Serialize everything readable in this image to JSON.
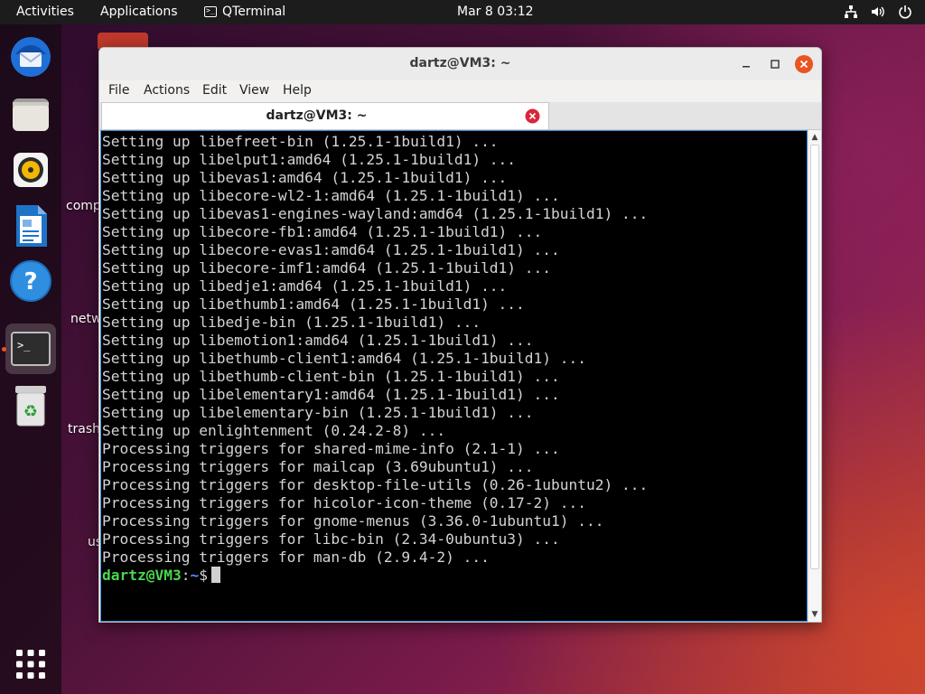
{
  "topbar": {
    "activities": "Activities",
    "applications": "Applications",
    "app_name": "QTerminal",
    "clock": "Mar 8  03:12",
    "tray_icons": [
      "network-icon",
      "volume-icon",
      "power-icon"
    ]
  },
  "dock": {
    "items": [
      {
        "name": "thunderbird-icon"
      },
      {
        "name": "files-icon"
      },
      {
        "name": "rhythmbox-icon"
      },
      {
        "name": "libreoffice-writer-icon"
      },
      {
        "name": "help-icon"
      },
      {
        "name": "terminal-icon",
        "active": true
      },
      {
        "name": "trash-icon"
      }
    ],
    "app_grid": "show-applications-icon"
  },
  "desktop": {
    "labels": [
      "comp",
      "netw",
      "trash",
      "us"
    ]
  },
  "window": {
    "title": "dartz@VM3: ~",
    "menu": [
      "File",
      "Actions",
      "Edit",
      "View",
      "Help"
    ],
    "tab_label": "dartz@VM3: ~",
    "accent": "#3b8ed8",
    "close_color": "#e95420"
  },
  "terminal": {
    "lines": [
      "Setting up libefreet-bin (1.25.1-1build1) ...",
      "Setting up libelput1:amd64 (1.25.1-1build1) ...",
      "Setting up libevas1:amd64 (1.25.1-1build1) ...",
      "Setting up libecore-wl2-1:amd64 (1.25.1-1build1) ...",
      "Setting up libevas1-engines-wayland:amd64 (1.25.1-1build1) ...",
      "Setting up libecore-fb1:amd64 (1.25.1-1build1) ...",
      "Setting up libecore-evas1:amd64 (1.25.1-1build1) ...",
      "Setting up libecore-imf1:amd64 (1.25.1-1build1) ...",
      "Setting up libedje1:amd64 (1.25.1-1build1) ...",
      "Setting up libethumb1:amd64 (1.25.1-1build1) ...",
      "Setting up libedje-bin (1.25.1-1build1) ...",
      "Setting up libemotion1:amd64 (1.25.1-1build1) ...",
      "Setting up libethumb-client1:amd64 (1.25.1-1build1) ...",
      "Setting up libethumb-client-bin (1.25.1-1build1) ...",
      "Setting up libelementary1:amd64 (1.25.1-1build1) ...",
      "Setting up libelementary-bin (1.25.1-1build1) ...",
      "Setting up enlightenment (0.24.2-8) ...",
      "Processing triggers for shared-mime-info (2.1-1) ...",
      "Processing triggers for mailcap (3.69ubuntu1) ...",
      "Processing triggers for desktop-file-utils (0.26-1ubuntu2) ...",
      "Processing triggers for hicolor-icon-theme (0.17-2) ...",
      "Processing triggers for gnome-menus (3.36.0-1ubuntu1) ...",
      "Processing triggers for libc-bin (2.34-0ubuntu3) ...",
      "Processing triggers for man-db (2.9.4-2) ..."
    ],
    "prompt_user": "dartz@VM3",
    "prompt_sep": ":",
    "prompt_path": "~",
    "prompt_symbol": "$"
  }
}
